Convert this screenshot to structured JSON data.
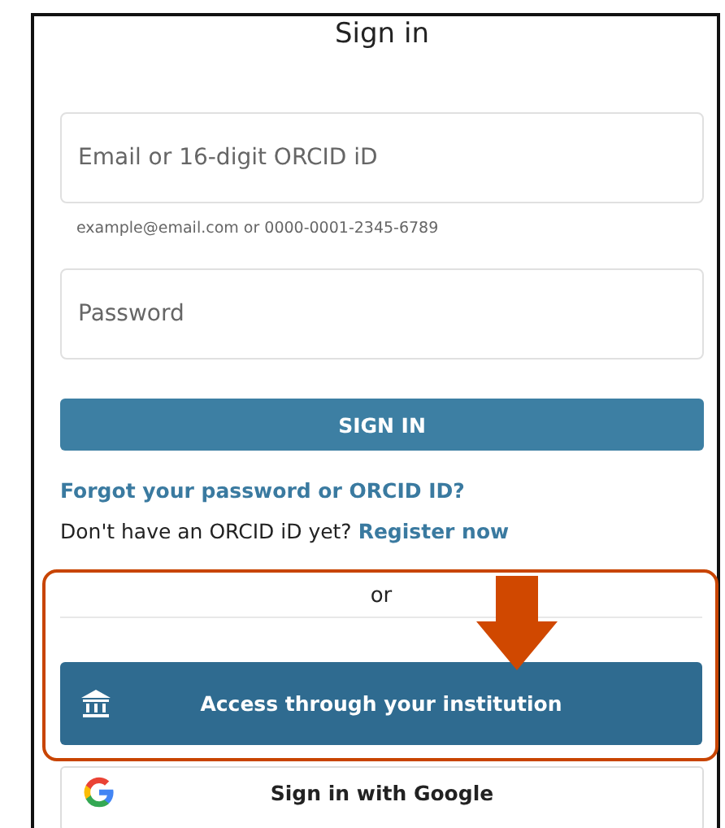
{
  "title": "Sign in",
  "email_field": {
    "placeholder": "Email or 16-digit ORCID iD"
  },
  "email_hint": "example@email.com or 0000-0001-2345-6789",
  "password_field": {
    "placeholder": "Password"
  },
  "sign_in_button": "SIGN IN",
  "forgot_link": "Forgot your password or ORCID ID?",
  "register_prompt": {
    "text": "Don't have an ORCID iD yet?",
    "link": "Register now"
  },
  "separator": "or",
  "institution_button": {
    "label": "Access through your institution"
  },
  "google_button": {
    "label": "Sign in with Google"
  }
}
